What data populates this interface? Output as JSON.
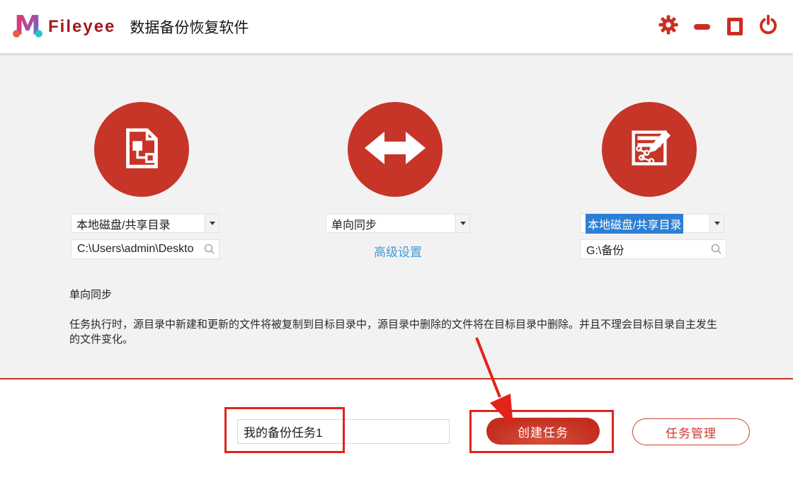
{
  "header": {
    "brand": "Fileyee",
    "title": "数据备份恢复软件"
  },
  "source": {
    "type": "本地磁盘/共享目录",
    "path": "C:\\Users\\admin\\Deskto"
  },
  "sync": {
    "mode": "单向同步",
    "advanced": "高级设置"
  },
  "target": {
    "type": "本地磁盘/共享目录",
    "path": "G:\\备份"
  },
  "info": {
    "title": "单向同步",
    "body": "任务执行时，源目录中新建和更新的文件将被复制到目标目录中，源目录中删除的文件将在目标目录中删除。并且不理会目标目录自主发生的文件变化。"
  },
  "footer": {
    "task_name": "我的备份任务1",
    "create": "创建任务",
    "manage": "任务管理"
  },
  "colors": {
    "accent_red": "#c63528",
    "brand_red": "#a5171d",
    "annotation_red": "#e2231a",
    "link_blue": "#3f9ad8",
    "selection_blue": "#2b7fd4"
  }
}
